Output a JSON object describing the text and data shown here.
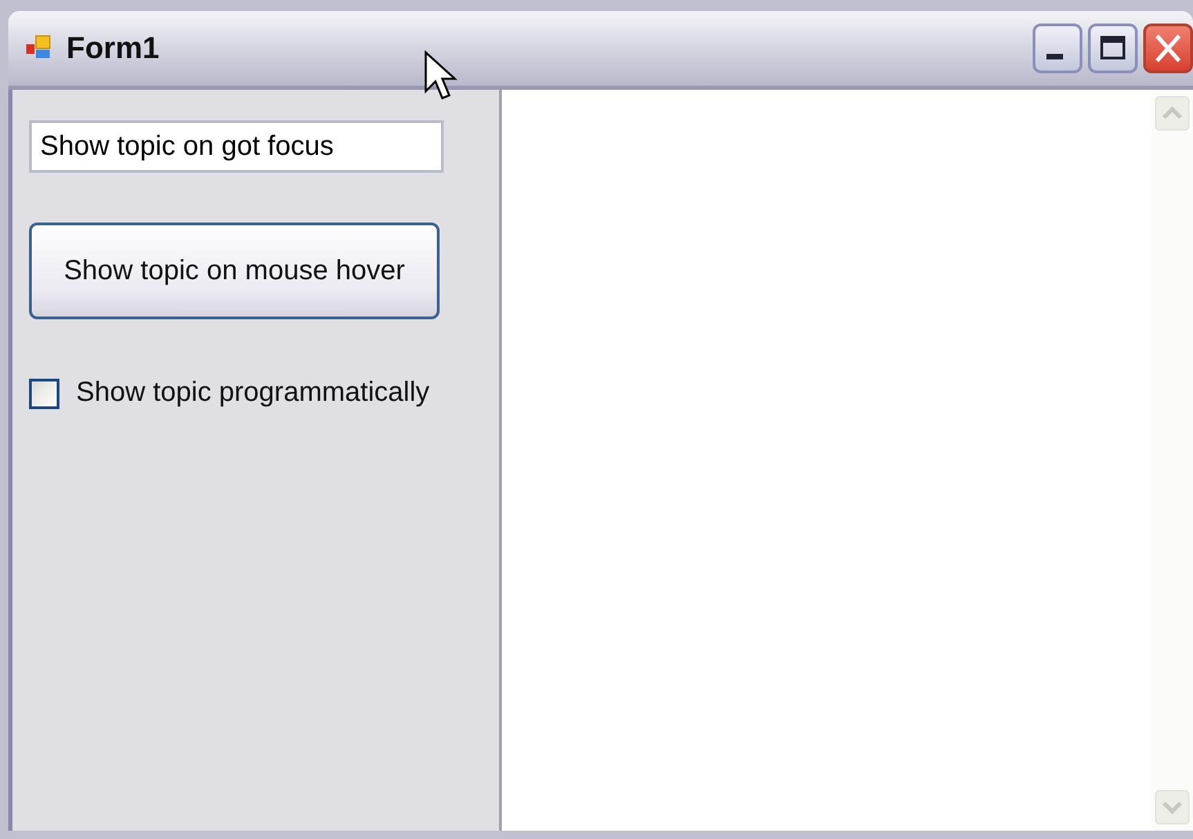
{
  "window": {
    "title": "Form1"
  },
  "text_field": {
    "value": "Show topic on got focus"
  },
  "button": {
    "label": "Show topic on mouse hover"
  },
  "checkbox": {
    "label": "Show topic programmatically",
    "checked": false
  }
}
